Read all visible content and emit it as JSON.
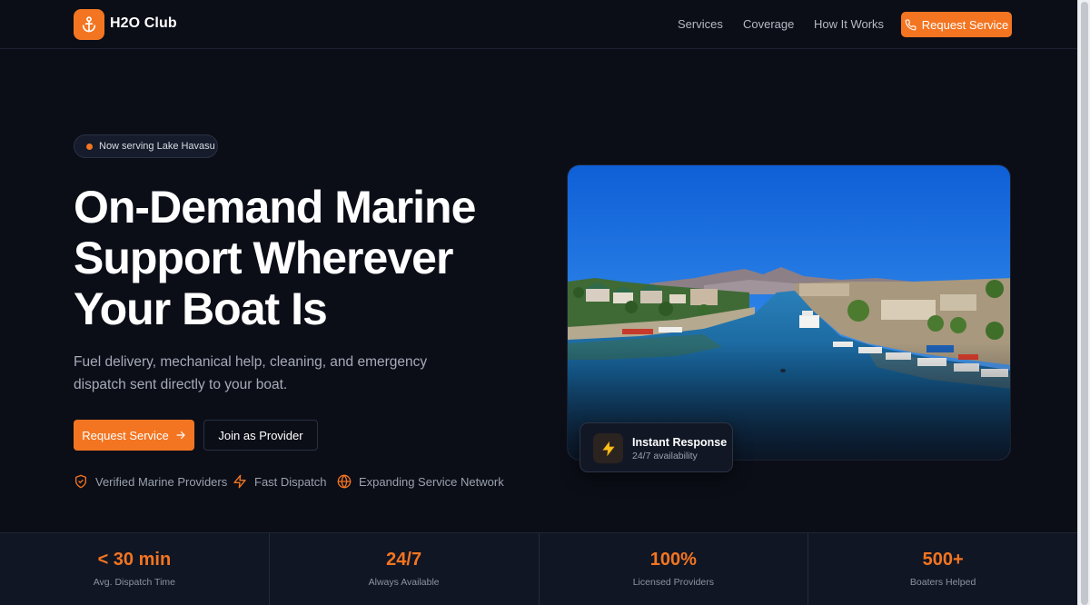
{
  "brand": {
    "name": "H2O Club",
    "accent": "#f37521",
    "logo_icon": "anchor-icon"
  },
  "nav": {
    "items": [
      {
        "label": "Services"
      },
      {
        "label": "Coverage"
      },
      {
        "label": "How It Works"
      }
    ],
    "cta_label": "Request Service",
    "cta_icon": "phone-icon"
  },
  "hero": {
    "badge": "Now serving Lake Havasu",
    "headline_lines": [
      "On-Demand Marine",
      "Support Wherever",
      "Your Boat Is"
    ],
    "subtext": "Fuel delivery, mechanical help, cleaning, and emergency dispatch sent directly to your boat.",
    "primary_button": "Request Service",
    "secondary_button": "Join as Provider",
    "features": [
      {
        "label": "Verified Marine Providers",
        "icon": "shield-icon"
      },
      {
        "label": "Fast Dispatch",
        "icon": "lightning-icon"
      },
      {
        "label": "Expanding Service Network",
        "icon": "globe-icon"
      }
    ],
    "image_alt": "lake-havasu-marina-photo",
    "float_card": {
      "icon": "lightning-icon",
      "title": "Instant Response",
      "subtitle": "24/7 availability"
    }
  },
  "stats": [
    {
      "value": "< 30 min",
      "label": "Avg. Dispatch Time"
    },
    {
      "value": "24/7",
      "label": "Always Available"
    },
    {
      "value": "100%",
      "label": "Licensed Providers"
    },
    {
      "value": "500+",
      "label": "Boaters Helped"
    }
  ]
}
